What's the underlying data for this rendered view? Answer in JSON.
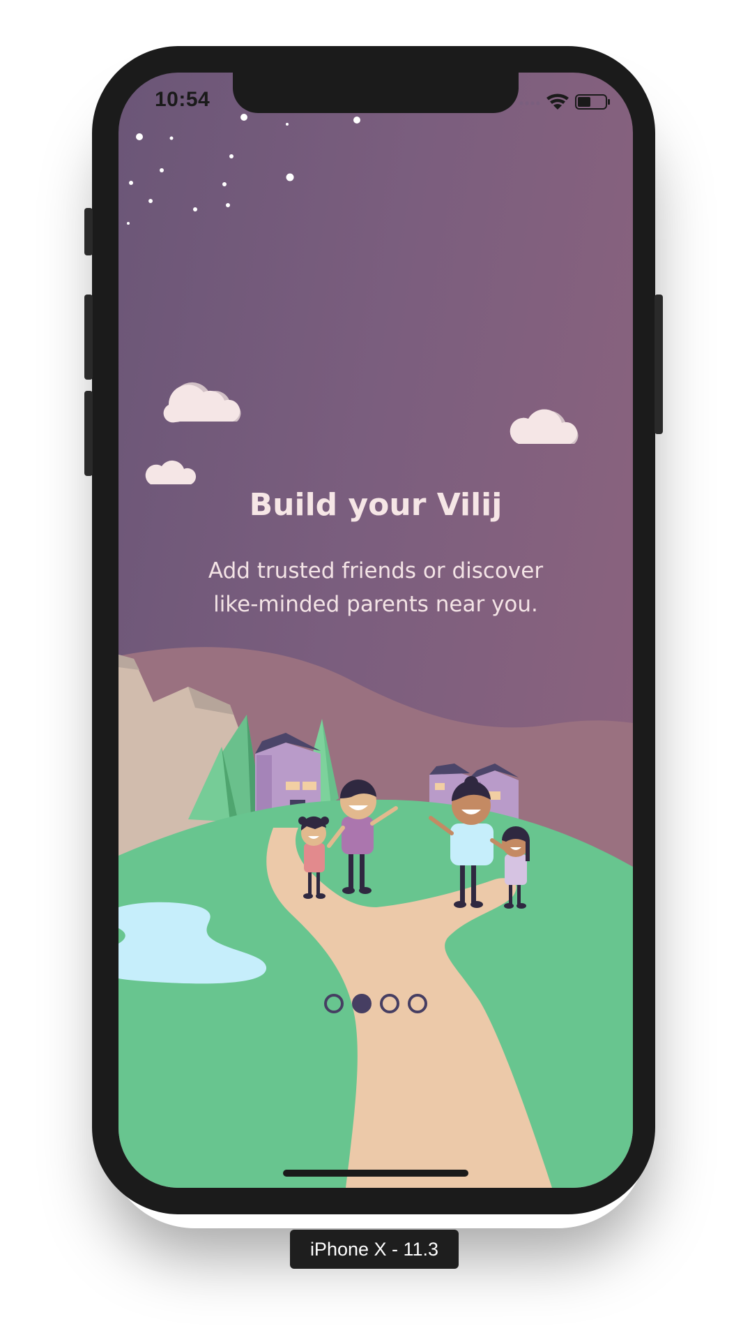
{
  "status_bar": {
    "time": "10:54"
  },
  "onboarding": {
    "title": "Build your Vilij",
    "subtitle_line1": "Add trusted friends or discover",
    "subtitle_line2": "like-minded parents near you.",
    "page_indicator": {
      "total": 4,
      "current": 2
    }
  },
  "simulator": {
    "device_label": "iPhone X - 11.3"
  },
  "colors": {
    "sky_left": "#6b5677",
    "sky_right": "#8e647e",
    "grass": "#68c58f",
    "path": "#ecc9a9",
    "lake": "#c6eefb",
    "text": "#f6e6e6",
    "indicator": "#463e62"
  }
}
